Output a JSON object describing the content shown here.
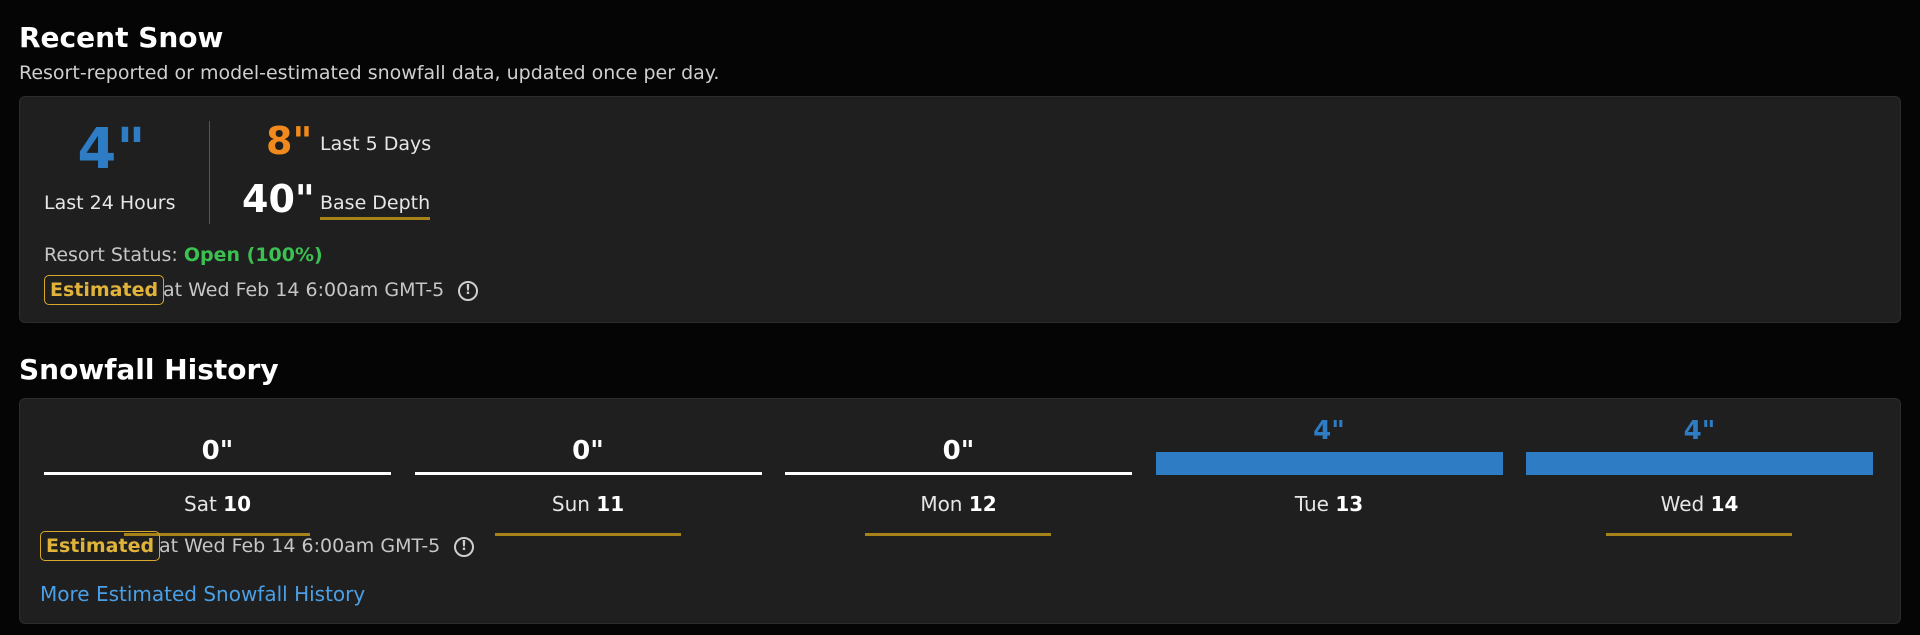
{
  "recent": {
    "title": "Recent Snow",
    "subtitle": "Resort-reported or model-estimated snowfall data, updated once per day.",
    "last24_value": "4\"",
    "last24_label": "Last 24 Hours",
    "last5_value": "8\"",
    "last5_label": "Last 5 Days",
    "base_value": "40\"",
    "base_label": "Base Depth",
    "status_label": "Resort Status:",
    "status_value": "Open (100%)",
    "badge": "Estimated",
    "timestamp": "at Wed Feb 14 6:00am GMT-5"
  },
  "history": {
    "title": "Snowfall History",
    "days": [
      {
        "label": "Sat",
        "num": "10",
        "value": "0\"",
        "snow": 0
      },
      {
        "label": "Sun",
        "num": "11",
        "value": "0\"",
        "snow": 0
      },
      {
        "label": "Mon",
        "num": "12",
        "value": "0\"",
        "snow": 0
      },
      {
        "label": "Tue",
        "num": "13",
        "value": "4\"",
        "snow": 4
      },
      {
        "label": "Wed",
        "num": "14",
        "value": "4\"",
        "snow": 4
      }
    ],
    "badge": "Estimated",
    "timestamp": "at Wed Feb 14 6:00am GMT-5",
    "more_link": "More Estimated Snowfall History"
  },
  "colors": {
    "snow_blue": "#2e7cc4",
    "orange": "#f08a1c",
    "open_green": "#3bc152",
    "badge_gold": "#e0b33a"
  },
  "icons": {
    "info": "info-circle-icon"
  }
}
